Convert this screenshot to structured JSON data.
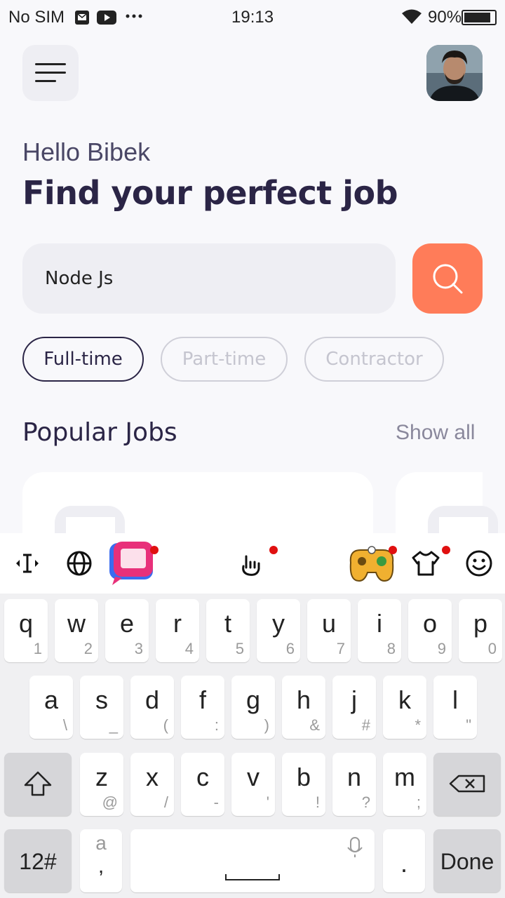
{
  "status_bar": {
    "carrier": "No SIM",
    "time": "19:13",
    "battery_percent": "90%",
    "battery_level": 0.9
  },
  "header": {
    "menu_icon": "hamburger-icon",
    "avatar_icon": "profile-avatar"
  },
  "greeting": "Hello Bibek",
  "headline": "Find your perfect job",
  "search": {
    "value": "Node Js",
    "button_icon": "search-icon"
  },
  "filters": [
    {
      "label": "Full-time",
      "active": true
    },
    {
      "label": "Part-time",
      "active": false
    },
    {
      "label": "Contractor",
      "active": false
    }
  ],
  "popular": {
    "title": "Popular Jobs",
    "show_all": "Show all"
  },
  "keyboard": {
    "row1": [
      {
        "k": "q",
        "s": "1"
      },
      {
        "k": "w",
        "s": "2"
      },
      {
        "k": "e",
        "s": "3"
      },
      {
        "k": "r",
        "s": "4"
      },
      {
        "k": "t",
        "s": "5"
      },
      {
        "k": "y",
        "s": "6"
      },
      {
        "k": "u",
        "s": "7"
      },
      {
        "k": "i",
        "s": "8"
      },
      {
        "k": "o",
        "s": "9"
      },
      {
        "k": "p",
        "s": "0"
      }
    ],
    "row2": [
      {
        "k": "a",
        "s": "\\"
      },
      {
        "k": "s",
        "s": "_"
      },
      {
        "k": "d",
        "s": "("
      },
      {
        "k": "f",
        "s": ":"
      },
      {
        "k": "g",
        "s": ")"
      },
      {
        "k": "h",
        "s": "&"
      },
      {
        "k": "j",
        "s": "#"
      },
      {
        "k": "k",
        "s": "*"
      },
      {
        "k": "l",
        "s": "\""
      }
    ],
    "row3": [
      {
        "k": "z",
        "s": "@"
      },
      {
        "k": "x",
        "s": "/"
      },
      {
        "k": "c",
        "s": "-"
      },
      {
        "k": "v",
        "s": "'"
      },
      {
        "k": "b",
        "s": "!"
      },
      {
        "k": "n",
        "s": "?"
      },
      {
        "k": "m",
        "s": ";"
      }
    ],
    "num_key": "12#",
    "comma_top": "a",
    "comma_bottom": ",",
    "period": ".",
    "done": "Done"
  }
}
